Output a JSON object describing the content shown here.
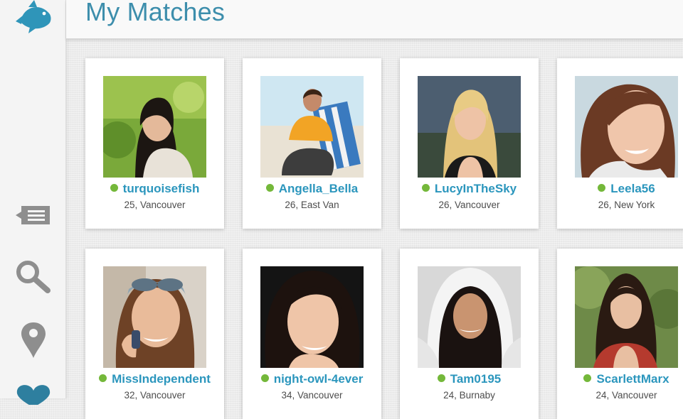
{
  "header": {
    "title": "My Matches"
  },
  "colors": {
    "accent": "#3d8eac",
    "link": "#2b96bd",
    "online": "#74b83a",
    "icon_gray": "#8e8e8e",
    "heart": "#2e7f9f"
  },
  "sidebar": {
    "items": [
      {
        "name": "messages",
        "icon": "speech-bubble-icon"
      },
      {
        "name": "search",
        "icon": "magnifier-icon"
      },
      {
        "name": "location",
        "icon": "map-pin-icon"
      },
      {
        "name": "matches",
        "icon": "heart-icon"
      }
    ]
  },
  "matches": [
    {
      "username": "turquoisefish",
      "details": "25, Vancouver",
      "online": true
    },
    {
      "username": "Angella_Bella",
      "details": "26, East Van",
      "online": true
    },
    {
      "username": "LucyInTheSky",
      "details": "26, Vancouver",
      "online": true
    },
    {
      "username": "Leela56",
      "details": "26, New York",
      "online": true
    },
    {
      "username": "MissIndependent",
      "details": "32, Vancouver",
      "online": true
    },
    {
      "username": "night-owl-4ever",
      "details": "34, Vancouver",
      "online": true
    },
    {
      "username": "Tam0195",
      "details": "24, Burnaby",
      "online": true
    },
    {
      "username": "ScarlettMarx",
      "details": "24, Vancouver",
      "online": true
    }
  ]
}
